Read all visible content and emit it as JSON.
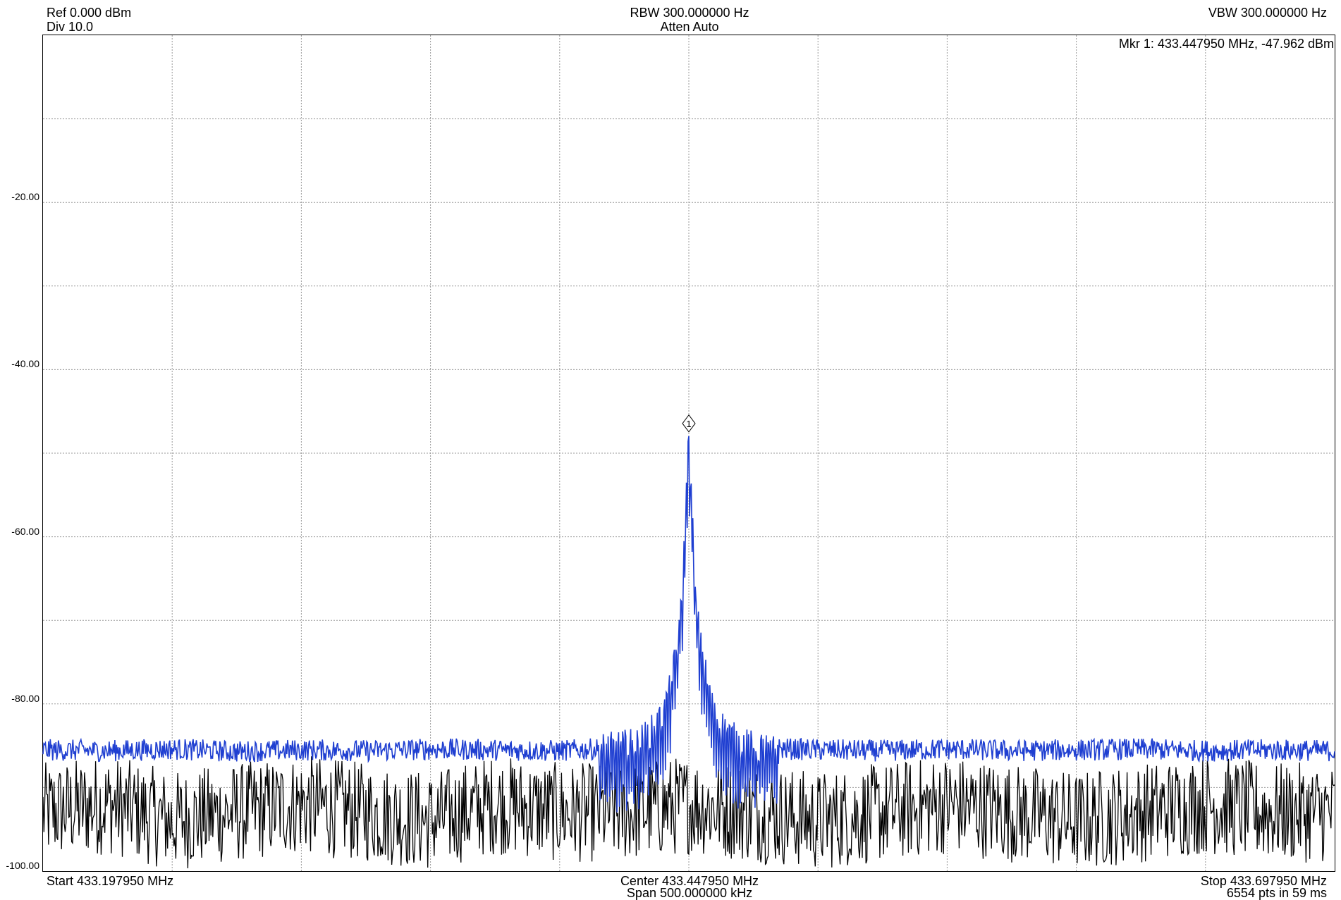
{
  "header": {
    "ref": "Ref 0.000 dBm",
    "div": "Div 10.0",
    "rbw": "RBW 300.000000 Hz",
    "atten": "Atten Auto",
    "vbw": "VBW 300.000000 Hz",
    "marker_readout": "Mkr 1: 433.447950 MHz, -47.962 dBm"
  },
  "footer": {
    "start": "Start 433.197950 MHz",
    "center": "Center 433.447950 MHz",
    "span": "Span 500.000000 kHz",
    "stop": "Stop 433.697950 MHz",
    "points": "6554 pts in 59 ms"
  },
  "marker": {
    "id": "1",
    "freq_mhz": 433.44795,
    "level_dbm": -47.962
  },
  "colors": {
    "trace_live": "#1f3fd1",
    "trace_min": "#000000",
    "grid": "#9a9a9a"
  },
  "chart_data": {
    "type": "line",
    "title": "",
    "xlabel": "",
    "ylabel": "",
    "xlim": [
      433.19795,
      433.69795
    ],
    "ylim": [
      -100,
      0
    ],
    "y_ticks": [
      "-20.00",
      "-40.00",
      "-60.00",
      "-80.00",
      "-100.00"
    ],
    "y_tick_values": [
      -20,
      -40,
      -60,
      -80,
      -100
    ],
    "grid": true,
    "x_divisions": 10,
    "y_divisions": 10,
    "series": [
      {
        "color": "#1f3fd1",
        "x": [
          433.19795,
          433.22295,
          433.24795,
          433.27295,
          433.29795,
          433.32295,
          433.34795,
          433.37295,
          433.39795,
          433.41795,
          433.42795,
          433.43295,
          433.43795,
          433.44095,
          433.44345,
          433.44545,
          433.44695,
          433.44795,
          433.44895,
          433.45045,
          433.45245,
          433.45545,
          433.45795,
          433.46295,
          433.46795,
          433.47795,
          433.49795,
          433.52295,
          433.54795,
          433.57295,
          433.59795,
          433.62295,
          433.64795,
          433.67295,
          433.69795
        ],
        "y": [
          -85.5,
          -85.6,
          -85.4,
          -85.7,
          -85.5,
          -85.6,
          -85.4,
          -85.5,
          -85.6,
          -85.3,
          -84.8,
          -83.5,
          -81.5,
          -78.0,
          -73.0,
          -67.0,
          -55.0,
          -47.962,
          -55.0,
          -67.0,
          -73.0,
          -78.0,
          -81.5,
          -83.5,
          -84.8,
          -85.3,
          -85.5,
          -85.6,
          -85.4,
          -85.6,
          -85.5,
          -85.4,
          -85.6,
          -85.5,
          -85.6
        ]
      },
      {
        "color": "#000000",
        "x": [
          433.19795,
          433.22295,
          433.24795,
          433.27295,
          433.29795,
          433.32295,
          433.34795,
          433.37295,
          433.39795,
          433.42295,
          433.44795,
          433.47295,
          433.49795,
          433.52295,
          433.54795,
          433.57295,
          433.59795,
          433.62295,
          433.64795,
          433.67295,
          433.69795
        ],
        "y": [
          -93,
          -92,
          -94,
          -93,
          -92,
          -93,
          -94,
          -92,
          -93,
          -93,
          -92,
          -93,
          -94,
          -93,
          -92,
          -93,
          -94,
          -93,
          -92,
          -93,
          -93
        ]
      }
    ]
  }
}
